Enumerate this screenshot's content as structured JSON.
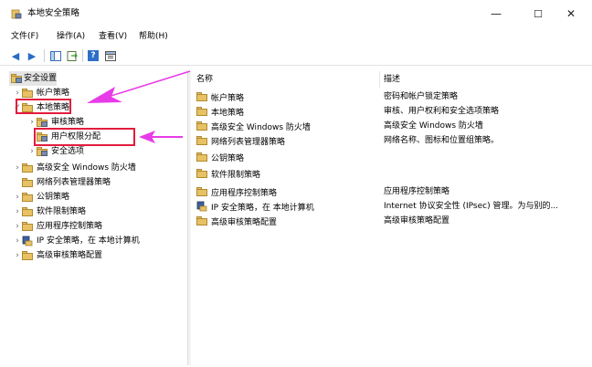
{
  "window": {
    "title": "本地安全策略",
    "minimize": "—",
    "maximize": "☐",
    "close": "✕"
  },
  "menu": {
    "items": [
      "文件(F)",
      "操作(A)",
      "查看(V)",
      "帮助(H)"
    ]
  },
  "toolbar": {
    "back": "◀",
    "forward": "▶",
    "help": "?"
  },
  "tree": {
    "root": "安全设置",
    "account": "帐户策略",
    "local": "本地策略",
    "audit": "审核策略",
    "rights": "用户权限分配",
    "options": "安全选项",
    "firewall": "高级安全 Windows 防火墙",
    "netlist": "网络列表管理器策略",
    "pubkey": "公钥策略",
    "softrestrict": "软件限制策略",
    "appctrl": "应用程序控制策略",
    "ipsec": "IP 安全策略，在 本地计算机",
    "advaudit": "高级审核策略配置"
  },
  "list": {
    "columns": {
      "name": "名称",
      "desc": "描述"
    },
    "rows": [
      {
        "name": "帐户策略",
        "desc": "密码和帐户锁定策略"
      },
      {
        "name": "本地策略",
        "desc": "审核、用户权利和安全选项策略"
      },
      {
        "name": "高级安全 Windows 防火墙",
        "desc": "高级安全 Windows 防火墙"
      },
      {
        "name": "网络列表管理器策略",
        "desc": "网络名称、图标和位置组策略。"
      },
      {
        "name": "公钥策略",
        "desc": ""
      },
      {
        "name": "软件限制策略",
        "desc": ""
      },
      {
        "name": "应用程序控制策略",
        "desc": "应用程序控制策略"
      },
      {
        "name": "IP 安全策略，在 本地计算机",
        "desc": "Internet 协议安全性 (IPsec) 管理。为与别的..."
      },
      {
        "name": "高级审核策略配置",
        "desc": "高级审核策略配置"
      }
    ]
  },
  "colors": {
    "annotation_red": "#e31c3d",
    "annotation_magenta": "#e83be8",
    "folder": "#e8c165"
  }
}
